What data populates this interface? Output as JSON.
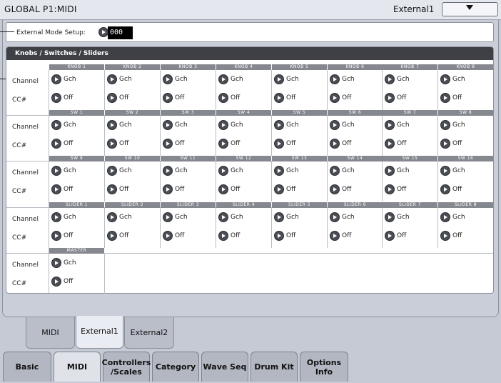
{
  "header": {
    "title": "GLOBAL P1:MIDI",
    "page_name": "External1"
  },
  "external_mode": {
    "label": "External Mode Setup:",
    "value": "000"
  },
  "kss": {
    "title": "Knobs / Switches / Sliders",
    "channel_label": "Channel",
    "cc_label": "CC#",
    "groups": [
      {
        "headers": [
          "KNOB 1",
          "KNOB 2",
          "KNOB 3",
          "KNOB 4",
          "KNOB 5",
          "KNOB 6",
          "KNOB 7",
          "KNOB 8"
        ]
      },
      {
        "headers": [
          "SW 1",
          "SW 2",
          "SW 3",
          "SW 4",
          "SW 5",
          "SW 6",
          "SW 7",
          "SW 8"
        ]
      },
      {
        "headers": [
          "SW 9",
          "SW 10",
          "SW 11",
          "SW 12",
          "SW 13",
          "SW 14",
          "SW 15",
          "SW 16"
        ]
      },
      {
        "headers": [
          "SLIDER 1",
          "SLIDER 2",
          "SLIDER 3",
          "SLIDER 4",
          "SLIDER 5",
          "SLIDER 6",
          "SLIDER 7",
          "SLIDER 8"
        ]
      },
      {
        "headers": [
          "MASTER"
        ]
      }
    ],
    "channel_value": "Gch",
    "cc_value": "Off"
  },
  "page_tabs": [
    "MIDI",
    "External1",
    "External2"
  ],
  "bottom_tabs": [
    [
      "Basic"
    ],
    [
      "MIDI"
    ],
    [
      "Controllers",
      "/Scales"
    ],
    [
      "Category"
    ],
    [
      "Wave Seq"
    ],
    [
      "Drum Kit"
    ],
    [
      "Options",
      "Info"
    ]
  ]
}
